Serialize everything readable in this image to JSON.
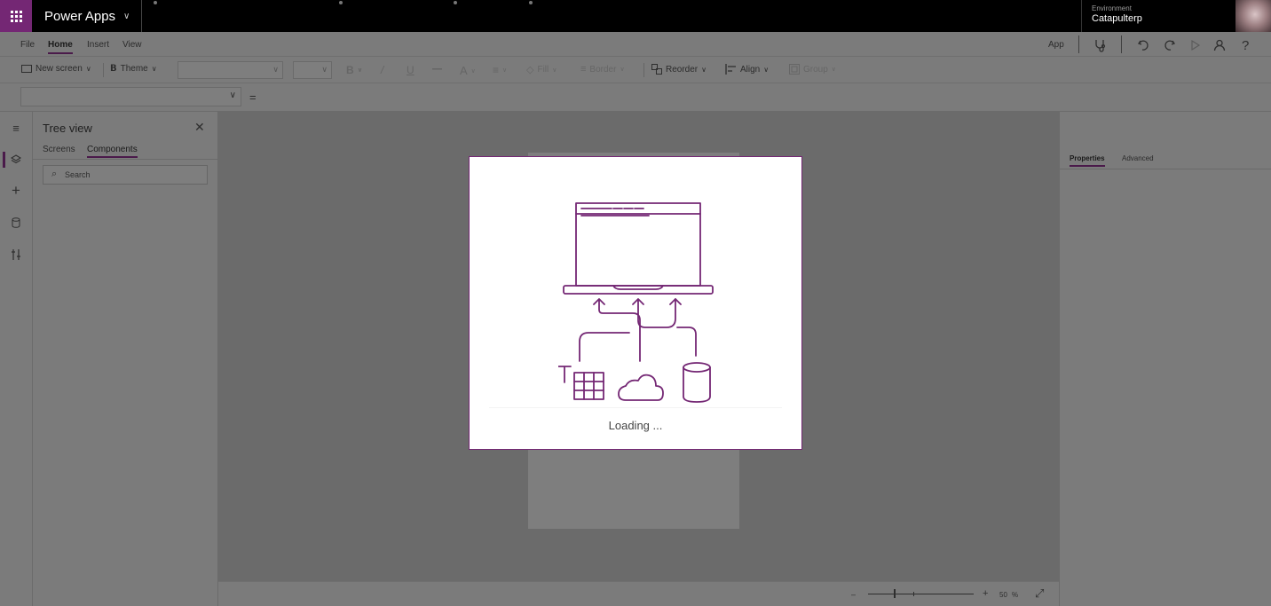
{
  "header": {
    "app_name": "Power Apps",
    "environment_label": "Environment",
    "environment_name": "Catapulterp"
  },
  "menu": {
    "items": [
      "File",
      "Home",
      "Insert",
      "View"
    ],
    "active": "Home",
    "app_label": "App"
  },
  "ribbon": {
    "new_screen": "New screen",
    "theme": "Theme",
    "fill": "Fill",
    "border": "Border",
    "reorder": "Reorder",
    "align": "Align",
    "group": "Group"
  },
  "formula": {
    "equals": "="
  },
  "tree_view": {
    "title": "Tree view",
    "tabs": [
      "Screens",
      "Components"
    ],
    "active_tab": "Components",
    "search_placeholder": "Search"
  },
  "properties_panel": {
    "tabs": [
      "Properties",
      "Advanced"
    ],
    "active_tab": "Properties"
  },
  "zoom": {
    "minus": "–",
    "plus": "+",
    "value": "50",
    "unit": "%"
  },
  "modal": {
    "loading_text": "Loading ..."
  },
  "colors": {
    "brand": "#742774",
    "overlay": "#7b7b7b"
  }
}
